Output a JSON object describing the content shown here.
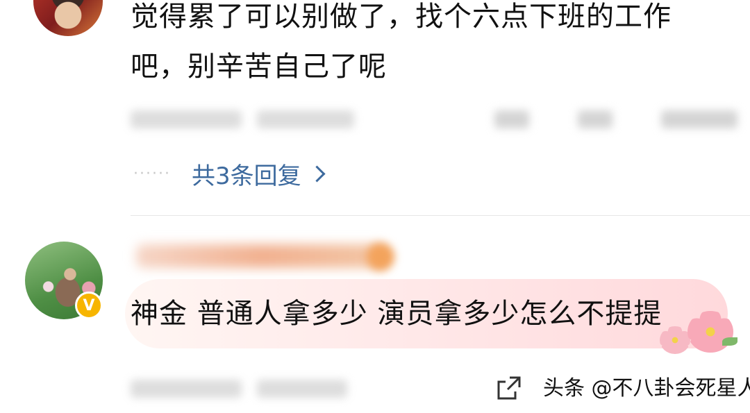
{
  "comments": [
    {
      "text_line1": "觉得累了可以别做了，找个六点下班的工作",
      "text_line2": "吧，别辛苦自己了呢",
      "replies_label": "共3条回复",
      "replies_dots": "······"
    },
    {
      "text": "神金 普通人拿多少 演员拿多少怎么不提提",
      "verified_badge": "V"
    }
  ],
  "watermark": {
    "text": "头条 @不八卦会死星人"
  },
  "colors": {
    "link": "#3d6a9e",
    "badge": "#f7b500",
    "bubble_end": "#ffd9dc"
  },
  "icons": [
    "share-icon",
    "chevron-right-icon",
    "verified-badge-icon"
  ]
}
